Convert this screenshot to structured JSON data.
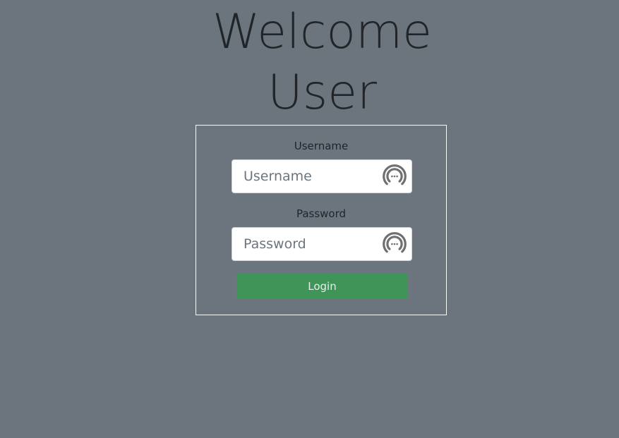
{
  "header": {
    "title_line_1": "Welcome",
    "title_line_2": "User"
  },
  "form": {
    "username_label": "Username",
    "username_placeholder": "Username",
    "username_value": "",
    "password_label": "Password",
    "password_placeholder": "Password",
    "password_value": "",
    "login_label": "Login",
    "field_icon": "password-manager-icon"
  },
  "colors": {
    "background": "#6c757d",
    "login_button": "#3f9457",
    "title_text": "#212529",
    "box_border": "#f8f9fa"
  }
}
